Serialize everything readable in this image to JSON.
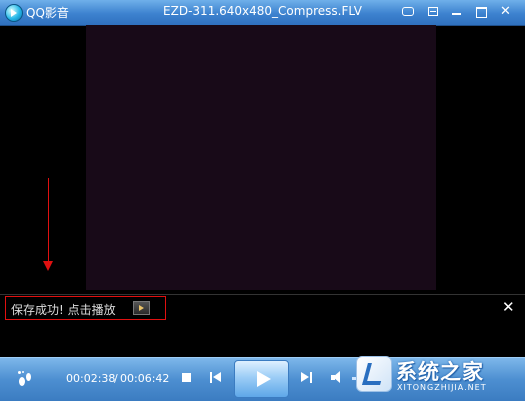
{
  "window": {
    "app_name": "QQ影音",
    "file_title": "EZD-311.640x480_Compress.FLV",
    "title_buttons": [
      {
        "icon": "pip-icon"
      },
      {
        "icon": "menu-icon"
      },
      {
        "icon": "minimize-icon"
      },
      {
        "icon": "maximize-icon"
      }
    ],
    "close_glyph": "✕"
  },
  "notification": {
    "message": "保存成功! 点击播放",
    "close_glyph": "✕"
  },
  "controls": {
    "time_current": "00:02:38",
    "time_separator": "/",
    "time_total": "00:06:42",
    "volume_level": 0.55
  },
  "watermark": {
    "main_text": "系统之家",
    "sub_text": "XITONGZHIJIA.NET"
  },
  "colors": {
    "titlebar": "#3d82cf",
    "controlbar": "#4d8fd1",
    "highlight_annotation": "#e01010",
    "video_background": "#180a18"
  }
}
